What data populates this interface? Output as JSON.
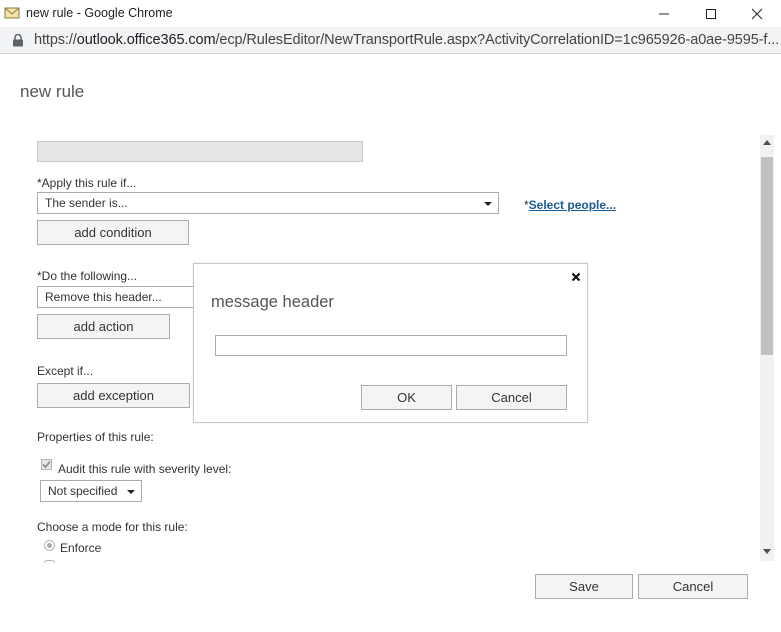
{
  "window": {
    "title": "new rule - Google Chrome"
  },
  "address_bar": {
    "url_prefix": "https://",
    "url_host": "outlook.office365.com",
    "url_path": "/ecp/RulesEditor/NewTransportRule.aspx?ActivityCorrelationID=1c965926-a0ae-9595-f..."
  },
  "page": {
    "title": "new rule",
    "name_value": "",
    "apply_label": "*Apply this rule if...",
    "apply_select": "The sender is...",
    "select_people": "Select people...",
    "select_people_prefix": "*",
    "add_condition": "add condition",
    "do_label": "*Do the following...",
    "do_select": "Remove this header...",
    "add_action": "add action",
    "except_label": "Except if...",
    "add_exception": "add exception",
    "properties_label": "Properties of this rule:",
    "audit_label": "Audit this rule with severity level:",
    "audit_checked": true,
    "severity_select": "Not specified",
    "mode_label": "Choose a mode for this rule:",
    "mode_enforce": "Enforce",
    "save_button": "Save",
    "cancel_button": "Cancel"
  },
  "dialog": {
    "title": "message header",
    "input_value": "",
    "ok_button": "OK",
    "cancel_button": "Cancel"
  }
}
